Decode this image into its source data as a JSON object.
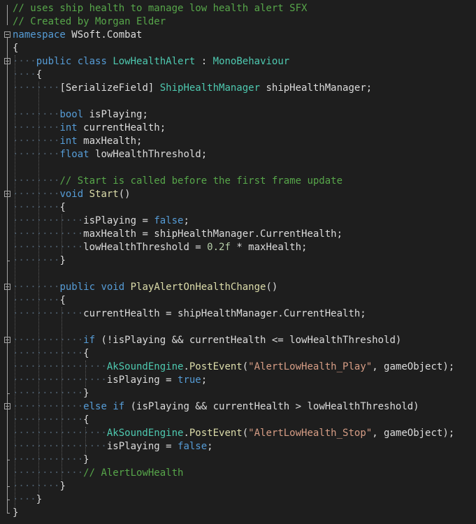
{
  "editor": {
    "colors": {
      "background": "#1e1e1e",
      "comment": "#57a64a",
      "keyword": "#569cd6",
      "type": "#4ec9b0",
      "identifier": "#dcdcdc",
      "method": "#dcdcaa",
      "string": "#d69d85",
      "number": "#b5cea8"
    },
    "lines": [
      {
        "fold": false,
        "tokens": [
          {
            "t": "cm",
            "v": "// uses ship health to manage low health alert SFX"
          }
        ]
      },
      {
        "fold": false,
        "tokens": [
          {
            "t": "cm",
            "v": "// Created by Morgan Elder"
          }
        ]
      },
      {
        "fold": true,
        "tokens": [
          {
            "t": "kw",
            "v": "namespace"
          },
          {
            "t": "id",
            "v": " WSoft.Combat"
          }
        ]
      },
      {
        "fold": false,
        "tokens": [
          {
            "t": "id",
            "v": "{"
          }
        ]
      },
      {
        "fold": true,
        "tokens": [
          {
            "t": "lead",
            "v": "····"
          },
          {
            "t": "kw",
            "v": "public"
          },
          {
            "t": "id",
            "v": " "
          },
          {
            "t": "kw",
            "v": "class"
          },
          {
            "t": "id",
            "v": " "
          },
          {
            "t": "ty",
            "v": "LowHealthAlert"
          },
          {
            "t": "id",
            "v": " : "
          },
          {
            "t": "ty",
            "v": "MonoBehaviour"
          }
        ]
      },
      {
        "fold": false,
        "tokens": [
          {
            "t": "lead",
            "v": "····"
          },
          {
            "t": "id",
            "v": "{"
          }
        ]
      },
      {
        "fold": false,
        "tokens": [
          {
            "t": "lead",
            "v": "········"
          },
          {
            "t": "id",
            "v": "[SerializeField] "
          },
          {
            "t": "ty",
            "v": "ShipHealthManager"
          },
          {
            "t": "id",
            "v": " shipHealthManager;"
          }
        ]
      },
      {
        "fold": false,
        "tokens": []
      },
      {
        "fold": false,
        "tokens": [
          {
            "t": "lead",
            "v": "········"
          },
          {
            "t": "kw",
            "v": "bool"
          },
          {
            "t": "id",
            "v": " isPlaying;"
          }
        ]
      },
      {
        "fold": false,
        "tokens": [
          {
            "t": "lead",
            "v": "········"
          },
          {
            "t": "kw",
            "v": "int"
          },
          {
            "t": "id",
            "v": " currentHealth;"
          }
        ]
      },
      {
        "fold": false,
        "tokens": [
          {
            "t": "lead",
            "v": "········"
          },
          {
            "t": "kw",
            "v": "int"
          },
          {
            "t": "id",
            "v": " maxHealth;"
          }
        ]
      },
      {
        "fold": false,
        "tokens": [
          {
            "t": "lead",
            "v": "········"
          },
          {
            "t": "kw",
            "v": "float"
          },
          {
            "t": "id",
            "v": " lowHealthThreshold;"
          }
        ]
      },
      {
        "fold": false,
        "tokens": []
      },
      {
        "fold": false,
        "tokens": [
          {
            "t": "lead",
            "v": "········"
          },
          {
            "t": "cm",
            "v": "// Start is called before the first frame update"
          }
        ]
      },
      {
        "fold": true,
        "tokens": [
          {
            "t": "lead",
            "v": "········"
          },
          {
            "t": "kw",
            "v": "void"
          },
          {
            "t": "id",
            "v": " "
          },
          {
            "t": "fn",
            "v": "Start"
          },
          {
            "t": "id",
            "v": "()"
          }
        ]
      },
      {
        "fold": false,
        "tokens": [
          {
            "t": "lead",
            "v": "········"
          },
          {
            "t": "id",
            "v": "{"
          }
        ]
      },
      {
        "fold": false,
        "tokens": [
          {
            "t": "lead",
            "v": "············"
          },
          {
            "t": "id",
            "v": "isPlaying = "
          },
          {
            "t": "kw",
            "v": "false"
          },
          {
            "t": "id",
            "v": ";"
          }
        ]
      },
      {
        "fold": false,
        "tokens": [
          {
            "t": "lead",
            "v": "············"
          },
          {
            "t": "id",
            "v": "maxHealth = shipHealthManager.CurrentHealth;"
          }
        ]
      },
      {
        "fold": false,
        "tokens": [
          {
            "t": "lead",
            "v": "············"
          },
          {
            "t": "id",
            "v": "lowHealthThreshold = "
          },
          {
            "t": "nu",
            "v": "0.2f"
          },
          {
            "t": "id",
            "v": " * maxHealth;"
          }
        ]
      },
      {
        "fold": false,
        "tokens": [
          {
            "t": "lead",
            "v": "········"
          },
          {
            "t": "id",
            "v": "}"
          }
        ]
      },
      {
        "fold": false,
        "tokens": []
      },
      {
        "fold": true,
        "tokens": [
          {
            "t": "lead",
            "v": "········"
          },
          {
            "t": "kw",
            "v": "public"
          },
          {
            "t": "id",
            "v": " "
          },
          {
            "t": "kw",
            "v": "void"
          },
          {
            "t": "id",
            "v": " "
          },
          {
            "t": "fn",
            "v": "PlayAlertOnHealthChange"
          },
          {
            "t": "id",
            "v": "()"
          }
        ]
      },
      {
        "fold": false,
        "tokens": [
          {
            "t": "lead",
            "v": "········"
          },
          {
            "t": "id",
            "v": "{"
          }
        ]
      },
      {
        "fold": false,
        "tokens": [
          {
            "t": "lead",
            "v": "············"
          },
          {
            "t": "id",
            "v": "currentHealth = shipHealthManager.CurrentHealth;"
          }
        ]
      },
      {
        "fold": false,
        "tokens": []
      },
      {
        "fold": true,
        "tokens": [
          {
            "t": "lead",
            "v": "············"
          },
          {
            "t": "kw",
            "v": "if"
          },
          {
            "t": "id",
            "v": " (!isPlaying && currentHealth <= lowHealthThreshold)"
          }
        ]
      },
      {
        "fold": false,
        "tokens": [
          {
            "t": "lead",
            "v": "············"
          },
          {
            "t": "id",
            "v": "{"
          }
        ]
      },
      {
        "fold": false,
        "tokens": [
          {
            "t": "lead",
            "v": "················"
          },
          {
            "t": "ty",
            "v": "AkSoundEngine"
          },
          {
            "t": "id",
            "v": "."
          },
          {
            "t": "fn",
            "v": "PostEvent"
          },
          {
            "t": "id",
            "v": "("
          },
          {
            "t": "st",
            "v": "\"AlertLowHealth_Play\""
          },
          {
            "t": "id",
            "v": ", gameObject);"
          }
        ]
      },
      {
        "fold": false,
        "tokens": [
          {
            "t": "lead",
            "v": "················"
          },
          {
            "t": "id",
            "v": "isPlaying = "
          },
          {
            "t": "kw",
            "v": "true"
          },
          {
            "t": "id",
            "v": ";"
          }
        ]
      },
      {
        "fold": false,
        "tokens": [
          {
            "t": "lead",
            "v": "············"
          },
          {
            "t": "id",
            "v": "}"
          }
        ]
      },
      {
        "fold": true,
        "tokens": [
          {
            "t": "lead",
            "v": "············"
          },
          {
            "t": "kw",
            "v": "else"
          },
          {
            "t": "id",
            "v": " "
          },
          {
            "t": "kw",
            "v": "if"
          },
          {
            "t": "id",
            "v": " (isPlaying && currentHealth > lowHealthThreshold)"
          }
        ]
      },
      {
        "fold": false,
        "tokens": [
          {
            "t": "lead",
            "v": "············"
          },
          {
            "t": "id",
            "v": "{"
          }
        ]
      },
      {
        "fold": false,
        "tokens": [
          {
            "t": "lead",
            "v": "················"
          },
          {
            "t": "ty",
            "v": "AkSoundEngine"
          },
          {
            "t": "id",
            "v": "."
          },
          {
            "t": "fn",
            "v": "PostEvent"
          },
          {
            "t": "id",
            "v": "("
          },
          {
            "t": "st",
            "v": "\"AlertLowHealth_Stop\""
          },
          {
            "t": "id",
            "v": ", gameObject);"
          }
        ]
      },
      {
        "fold": false,
        "tokens": [
          {
            "t": "lead",
            "v": "················"
          },
          {
            "t": "id",
            "v": "isPlaying = "
          },
          {
            "t": "kw",
            "v": "false"
          },
          {
            "t": "id",
            "v": ";"
          }
        ]
      },
      {
        "fold": false,
        "tokens": [
          {
            "t": "lead",
            "v": "············"
          },
          {
            "t": "id",
            "v": "}"
          }
        ]
      },
      {
        "fold": false,
        "tokens": [
          {
            "t": "lead",
            "v": "············"
          },
          {
            "t": "cm",
            "v": "// AlertLowHealth"
          }
        ]
      },
      {
        "fold": false,
        "tokens": [
          {
            "t": "lead",
            "v": "········"
          },
          {
            "t": "id",
            "v": "}"
          }
        ]
      },
      {
        "fold": false,
        "tokens": [
          {
            "t": "lead",
            "v": "····"
          },
          {
            "t": "id",
            "v": "}"
          }
        ]
      },
      {
        "fold": false,
        "tokens": [
          {
            "t": "id",
            "v": "}"
          }
        ]
      }
    ]
  }
}
